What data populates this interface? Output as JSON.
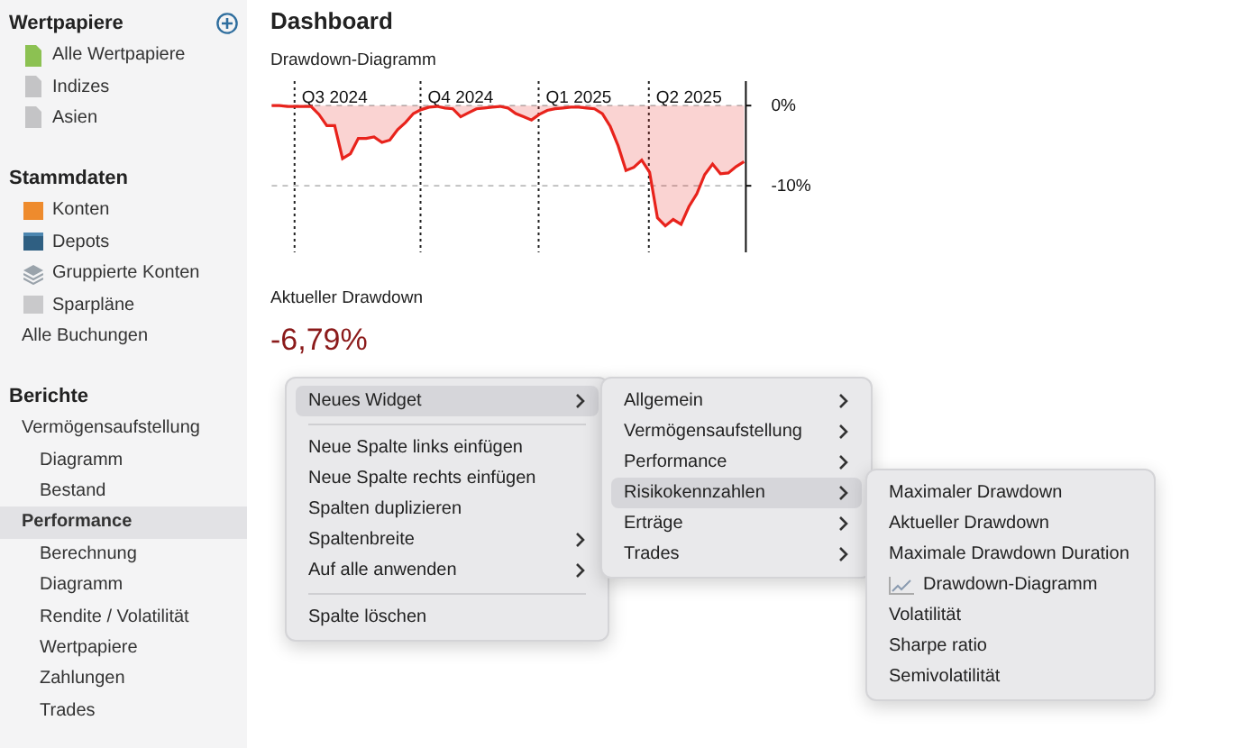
{
  "sidebar": {
    "sections": [
      {
        "title": "Wertpapiere",
        "add_button": true,
        "items": [
          {
            "label": "Alle Wertpapiere",
            "kind": "security",
            "selected": false
          },
          {
            "label": "Indizes",
            "kind": "index",
            "selected": false
          },
          {
            "label": "Asien",
            "kind": "index",
            "selected": false
          }
        ]
      },
      {
        "title": "Stammdaten",
        "add_button": false,
        "items": [
          {
            "label": "Konten",
            "kind": "account",
            "selected": false
          },
          {
            "label": "Depots",
            "kind": "depot",
            "selected": false
          },
          {
            "label": "Gruppierte Konten",
            "kind": "group",
            "selected": false
          },
          {
            "label": "Sparpläne",
            "kind": "plan",
            "selected": false
          },
          {
            "label": "Alle Buchungen",
            "selected": false
          }
        ]
      },
      {
        "title": "Berichte",
        "add_button": false,
        "items": [
          {
            "label": "Vermögensaufstellung",
            "selected": false,
            "children": [
              {
                "label": "Diagramm",
                "selected": false
              },
              {
                "label": "Bestand",
                "selected": false
              }
            ]
          },
          {
            "label": "Performance",
            "selected": true,
            "children": [
              {
                "label": "Berechnung",
                "selected": false
              },
              {
                "label": "Diagramm",
                "selected": false
              },
              {
                "label": "Rendite / Volatilität",
                "selected": false
              },
              {
                "label": "Wertpapiere",
                "selected": false
              },
              {
                "label": "Zahlungen",
                "selected": false
              },
              {
                "label": "Trades",
                "selected": false
              }
            ]
          }
        ]
      }
    ]
  },
  "main": {
    "title": "Dashboard",
    "widgets": [
      {
        "kind": "chart",
        "title": "Drawdown-Diagramm",
        "chart_data": {
          "type": "area",
          "categories": [
            null,
            null,
            null,
            null,
            null,
            null,
            null,
            null,
            "Q3 2024",
            null,
            null,
            null,
            null,
            null,
            null,
            null,
            null,
            null,
            null,
            null,
            null,
            null,
            null,
            null,
            "Q4 2024",
            null,
            null,
            null,
            null,
            null,
            null,
            null,
            null,
            null,
            null,
            null,
            null,
            null,
            null,
            "Q1 2025",
            null,
            null,
            null,
            null,
            null,
            null,
            null,
            null,
            null,
            null,
            null,
            null,
            null,
            "Q2 2025",
            null,
            null,
            null,
            null,
            null,
            null,
            null
          ],
          "series": [
            {
              "color": "#e8231c",
              "values": [
                0,
                0,
                -0.1,
                -0.1,
                -0.1,
                -0.1,
                -1.1,
                -2.5,
                -2.5,
                -6.6,
                -6,
                -4.1,
                -4.1,
                -3.9,
                -4.6,
                -4.3,
                -3,
                -2.1,
                -1,
                -0.5,
                -0.2,
                -0.1,
                -0.3,
                -0.4,
                -1.4,
                -0.9,
                -0.4,
                -0.3,
                -0.2,
                -0.1,
                -0.3,
                -1,
                -1.4,
                -1.8,
                -1.1,
                -0.6,
                -0.4,
                -0.3,
                -0.2,
                -0.2,
                -0.3,
                -0.4,
                -1,
                -2.6,
                -5,
                -8.1,
                -7.7,
                -6.8,
                -8.3,
                -14,
                -15,
                -14.2,
                -14.8,
                -12.6,
                -11,
                -8.6,
                -7.3,
                -8.5,
                -8.4,
                -7.6,
                -7
              ]
            }
          ],
          "ylim": [
            -18.3,
            3.5
          ],
          "yticks": [
            {
              "value": 0,
              "label": "0%"
            },
            {
              "value": -10,
              "label": "-10%"
            }
          ]
        }
      },
      {
        "kind": "metric",
        "title": "Aktueller Drawdown",
        "value": "-6,79%"
      }
    ]
  },
  "menus": [
    {
      "items": [
        {
          "kind": "item",
          "label": "Neues Widget",
          "submenu": true,
          "selected": true
        },
        {
          "kind": "separator"
        },
        {
          "kind": "item",
          "label": "Neue Spalte links einfügen",
          "submenu": false,
          "selected": false
        },
        {
          "kind": "item",
          "label": "Neue Spalte rechts einfügen",
          "submenu": false,
          "selected": false
        },
        {
          "kind": "item",
          "label": "Spalten duplizieren",
          "submenu": false,
          "selected": false
        },
        {
          "kind": "item",
          "label": "Spaltenbreite",
          "submenu": true,
          "selected": false
        },
        {
          "kind": "item",
          "label": "Auf alle anwenden",
          "submenu": true,
          "selected": false
        },
        {
          "kind": "separator"
        },
        {
          "kind": "item",
          "label": "Spalte löschen",
          "submenu": false,
          "selected": false
        }
      ]
    },
    {
      "items": [
        {
          "kind": "item",
          "label": "Allgemein",
          "submenu": true,
          "selected": false
        },
        {
          "kind": "item",
          "label": "Vermögensaufstellung",
          "submenu": true,
          "selected": false
        },
        {
          "kind": "item",
          "label": "Performance",
          "submenu": true,
          "selected": false
        },
        {
          "kind": "item",
          "label": "Risikokennzahlen",
          "submenu": true,
          "selected": true
        },
        {
          "kind": "item",
          "label": "Erträge",
          "submenu": true,
          "selected": false
        },
        {
          "kind": "item",
          "label": "Trades",
          "submenu": true,
          "selected": false
        }
      ]
    },
    {
      "items": [
        {
          "kind": "item",
          "label": "Maximaler Drawdown",
          "submenu": false,
          "selected": false
        },
        {
          "kind": "item",
          "label": "Aktueller Drawdown",
          "submenu": false,
          "selected": false
        },
        {
          "kind": "item",
          "label": "Maximale Drawdown Duration",
          "submenu": false,
          "selected": false
        },
        {
          "kind": "chart_item",
          "label": "Drawdown-Diagramm",
          "submenu": false,
          "selected": false
        },
        {
          "kind": "item",
          "label": "Volatilität",
          "submenu": false,
          "selected": false
        },
        {
          "kind": "item",
          "label": "Sharpe ratio",
          "submenu": false,
          "selected": false
        },
        {
          "kind": "item",
          "label": "Semivolatilität",
          "submenu": false,
          "selected": false
        }
      ]
    }
  ]
}
